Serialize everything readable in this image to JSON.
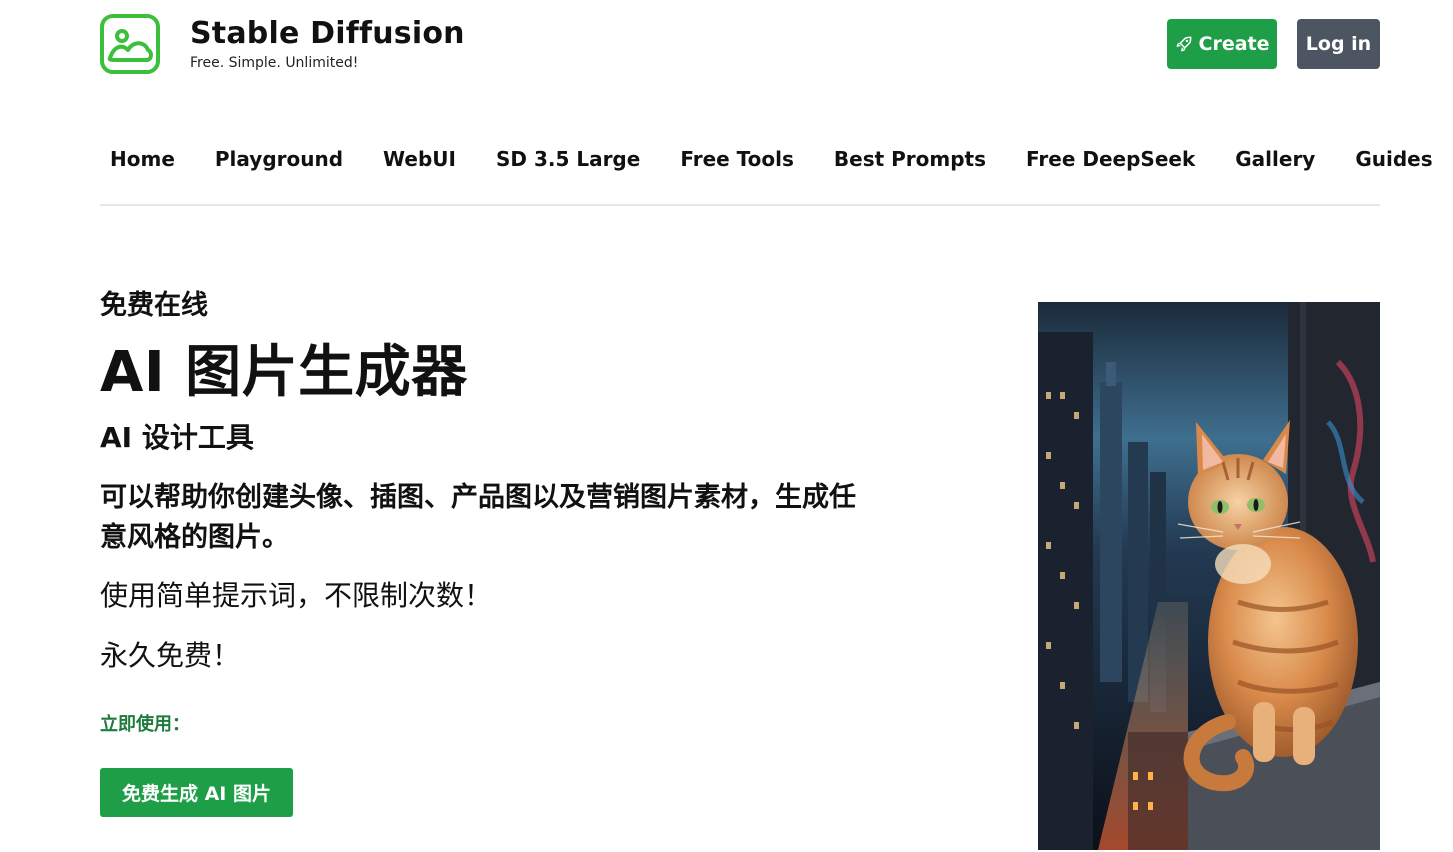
{
  "header": {
    "logo_icon": "image-cloud-icon",
    "brand_title": "Stable Diffusion",
    "brand_tagline": "Free. Simple. Unlimited!",
    "create_label": "Create",
    "create_icon": "rocket-icon",
    "login_label": "Log in",
    "accent_color": "#1e9e47",
    "login_color": "#4d5563"
  },
  "nav": {
    "items": [
      {
        "label": "Home"
      },
      {
        "label": "Playground"
      },
      {
        "label": "WebUI"
      },
      {
        "label": "SD 3.5 Large"
      },
      {
        "label": "Free Tools"
      },
      {
        "label": "Best Prompts"
      },
      {
        "label": "Free DeepSeek"
      },
      {
        "label": "Gallery"
      },
      {
        "label": "Guides"
      }
    ]
  },
  "hero": {
    "kicker": "免费在线",
    "title": "AI 图片生成器",
    "subtitle": "AI 设计工具",
    "description": "可以帮助你创建头像、插图、产品图以及营销图片素材，生成任意风格的图片。",
    "line1": "使用简单提示词，不限制次数！",
    "line2": "永久免费！",
    "cta_label": "立即使用：",
    "cta_button": "免费生成 AI 图片",
    "image": "cat-on-city-ledge-image"
  }
}
